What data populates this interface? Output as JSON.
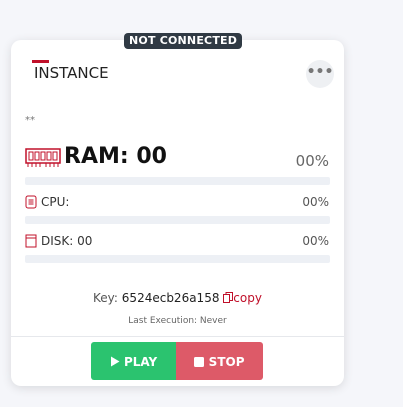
{
  "status_badge": "NOT CONNECTED",
  "instance": {
    "name": "INSTANCE",
    "more_label": "•••",
    "description": "**",
    "ram": {
      "label": "RAM: 00",
      "percent": "00%"
    },
    "cpu": {
      "label": "CPU:",
      "percent": "00%"
    },
    "disk": {
      "label": "DISK: 00",
      "percent": "00%"
    },
    "key_label": "Key:",
    "key_value": "6524ecb26a158",
    "copy_label": "copy",
    "last_execution": "Last Execution: Never",
    "play_label": "PLAY",
    "stop_label": "STOP"
  },
  "colors": {
    "accent": "#c0102a",
    "play": "#2bc36f",
    "stop": "#dd5a68"
  },
  "icons": [
    "ram-icon",
    "cpu-icon",
    "disk-icon",
    "copy-icon",
    "play-icon",
    "stop-icon",
    "more-icon"
  ]
}
